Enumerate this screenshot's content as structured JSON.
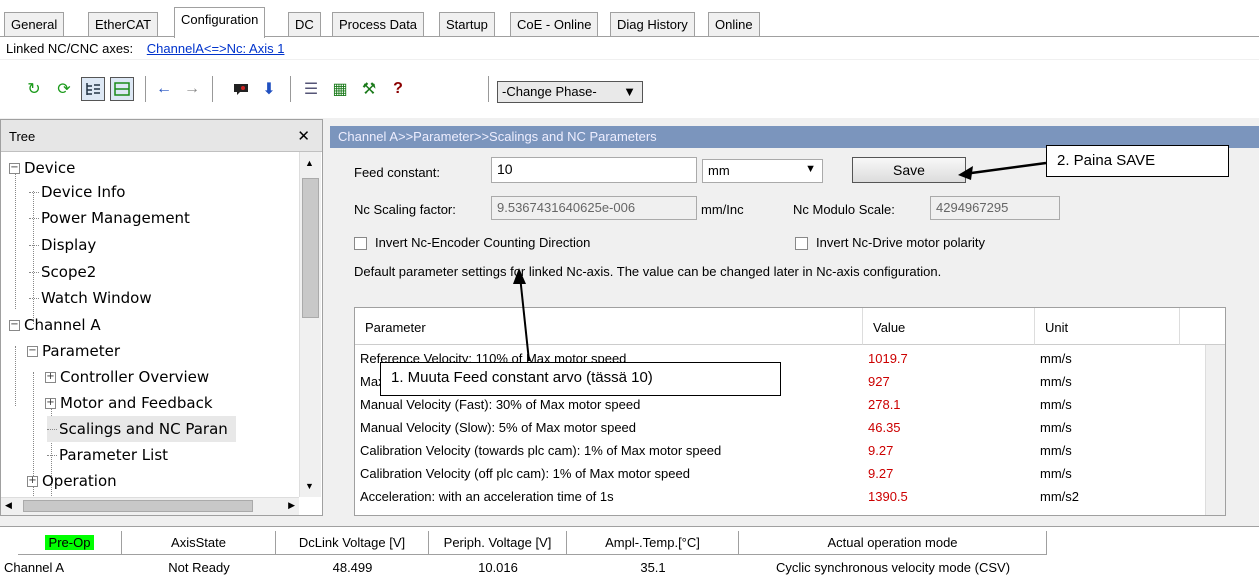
{
  "tabs": [
    "General",
    "EtherCAT",
    "Configuration",
    "DC",
    "Process Data",
    "Startup",
    "CoE - Online",
    "Diag History",
    "Online"
  ],
  "linked": {
    "label": "Linked NC/CNC axes:",
    "link": "ChannelA<=>Nc: Axis 1"
  },
  "toolbar": {
    "phase_select": "-Change Phase-"
  },
  "tree": {
    "title": "Tree",
    "items": [
      "Device",
      "Device Info",
      "Power Management",
      "Display",
      "Scope2",
      "Watch Window",
      "Channel A",
      "Parameter",
      "Controller Overview",
      "Motor and Feedback",
      "Scalings and NC Paran",
      "Parameter List",
      "Operation"
    ]
  },
  "panel": {
    "breadcrumb": "Channel A>>Parameter>>Scalings and NC Parameters",
    "feed_label": "Feed constant:",
    "feed_value": "10",
    "feed_unit": "mm",
    "save_label": "Save",
    "scaling_label": "Nc Scaling factor:",
    "scaling_value": "9.5367431640625e-006",
    "scaling_unit": "mm/Inc",
    "modulo_label": "Nc Modulo Scale:",
    "modulo_value": "4294967295",
    "invert_encoder": "Invert Nc-Encoder Counting Direction",
    "invert_drive": "Invert Nc-Drive motor polarity",
    "note": "Default parameter settings for linked Nc-axis. The value can be changed later in Nc-axis configuration."
  },
  "table": {
    "headers": [
      "Parameter",
      "Value",
      "Unit"
    ],
    "rows": [
      [
        "Reference Velocity: 110% of Max motor speed",
        "1019.7",
        "mm/s"
      ],
      [
        "Maximal Velocity: 100% of Max motor speed",
        "927",
        "mm/s"
      ],
      [
        "Manual Velocity (Fast): 30% of Max motor speed",
        "278.1",
        "mm/s"
      ],
      [
        "Manual Velocity (Slow): 5% of Max motor speed",
        "46.35",
        "mm/s"
      ],
      [
        "Calibration Velocity (towards plc cam): 1% of Max motor speed",
        "9.27",
        "mm/s"
      ],
      [
        "Calibration Velocity (off plc cam): 1% of Max motor speed",
        "9.27",
        "mm/s"
      ],
      [
        "Acceleration: with an acceleration time of 1s",
        "1390.5",
        "mm/s2"
      ]
    ]
  },
  "callouts": {
    "step1": "1. Muuta Feed constant arvo (tässä 10)",
    "step2": "2. Paina SAVE"
  },
  "status": {
    "headers": [
      "Pre-Op",
      "AxisState",
      "DcLink Voltage [V]",
      "Periph. Voltage [V]",
      "Ampl-.Temp.[°C]",
      "Actual operation mode"
    ],
    "values": [
      "Channel A",
      "Not Ready",
      "48.499",
      "10.016",
      "35.1",
      "Cyclic synchronous velocity mode (CSV)"
    ],
    "preop_color": "#00ff00"
  }
}
